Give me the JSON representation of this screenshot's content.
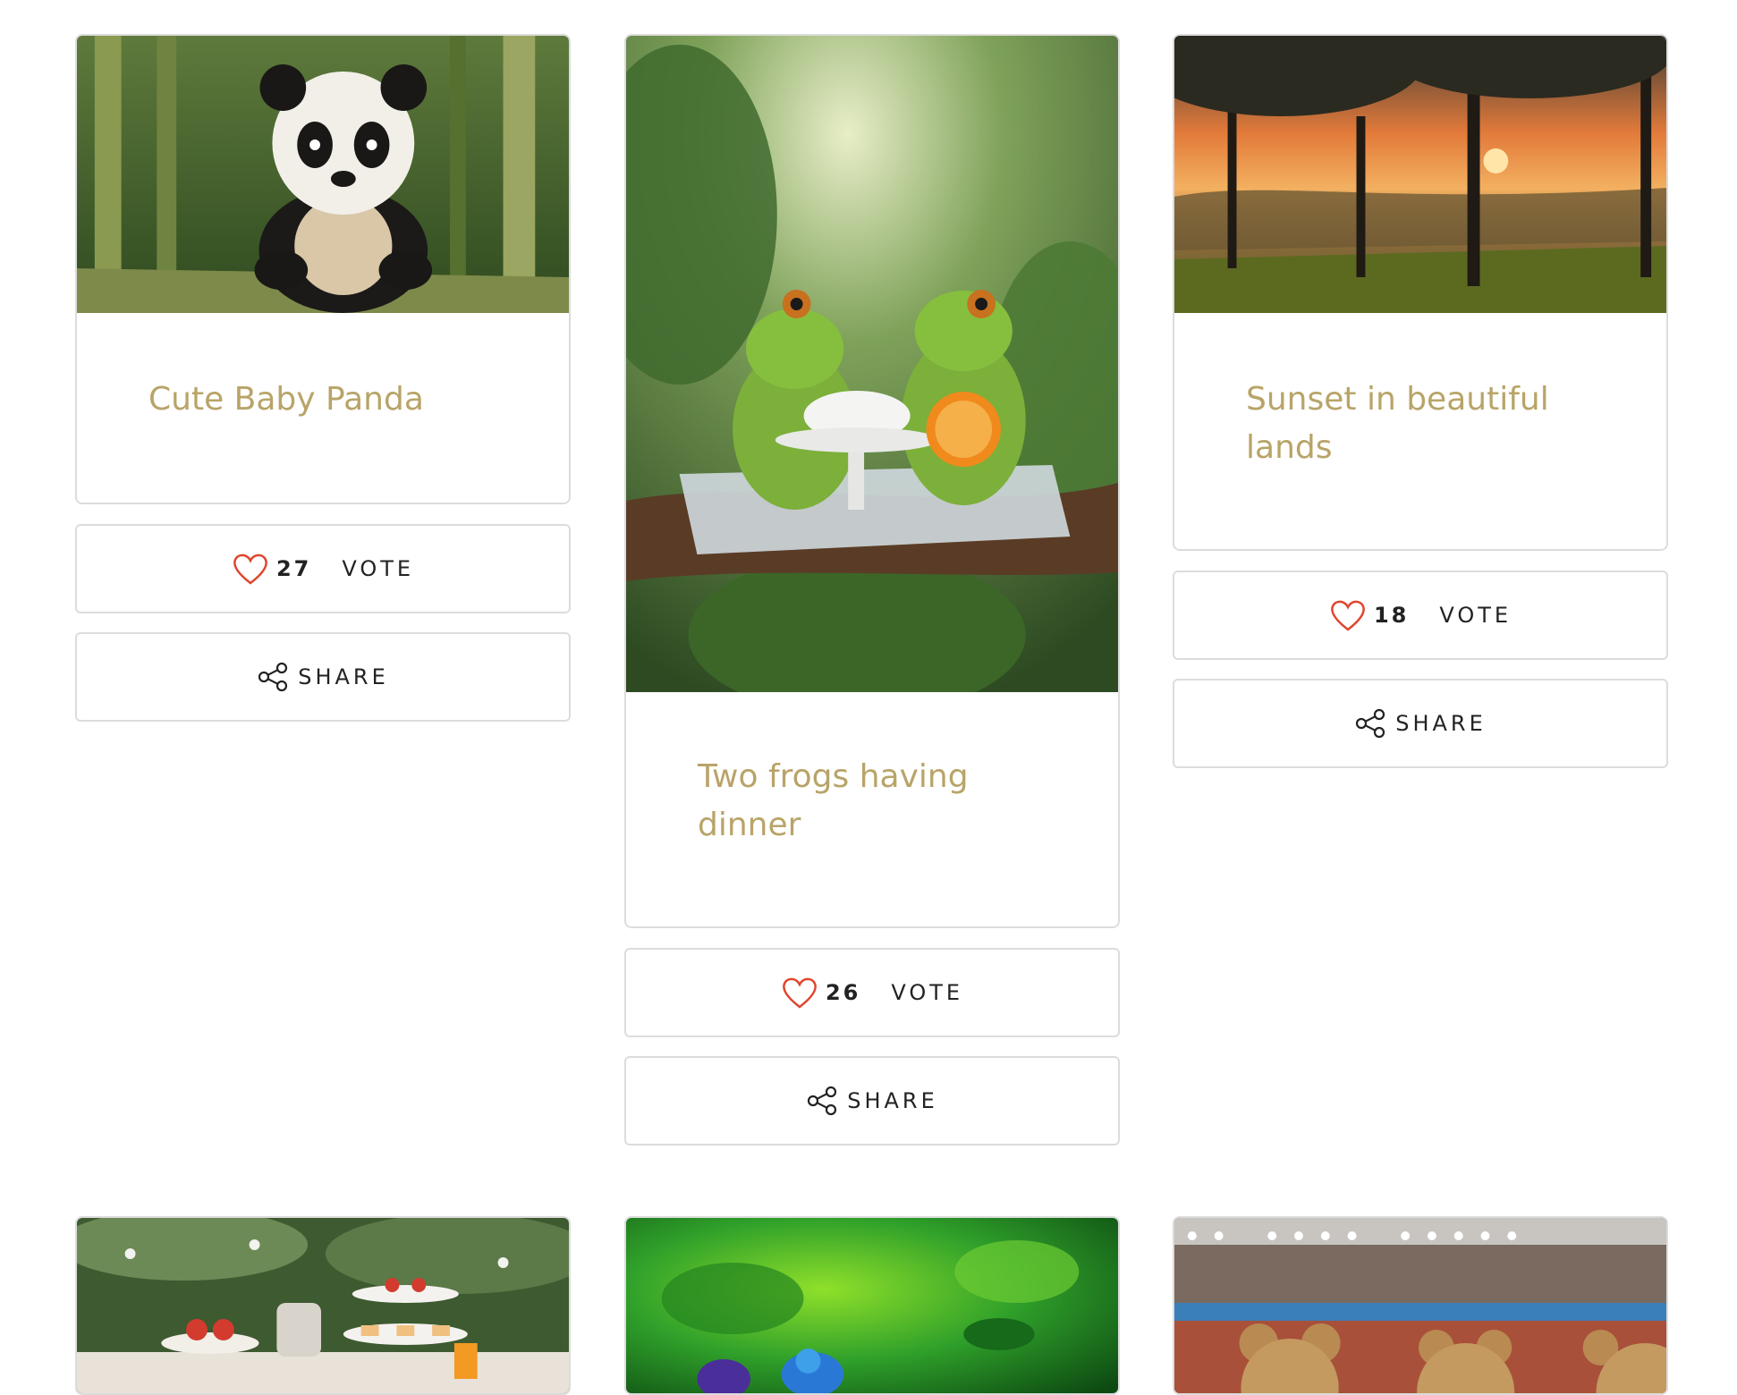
{
  "cards": [
    {
      "title": "Cute Baby Panda",
      "votes": "27",
      "vote_label": "VOTE",
      "share_label": "SHARE",
      "image": "baby panda sitting on bamboo in forest"
    },
    {
      "title": "Two frogs having dinner",
      "votes": "26",
      "vote_label": "VOTE",
      "share_label": "SHARE",
      "image": "two frogs sharing tea on a branch"
    },
    {
      "title": "Sunset in beautiful lands",
      "votes": "18",
      "vote_label": "VOTE",
      "share_label": "SHARE",
      "image": "sunset behind trees over green hills"
    },
    {
      "image": "afternoon tea table in garden"
    },
    {
      "image": "colorful birds on green background"
    },
    {
      "image": "teddy bears in a stadium"
    }
  ],
  "colors": {
    "title": "#b8a468",
    "heart": "#e0452e",
    "border": "#dcdcdc",
    "button_text": "#222222"
  },
  "icons": {
    "vote": "heart-icon",
    "share": "share-icon"
  }
}
